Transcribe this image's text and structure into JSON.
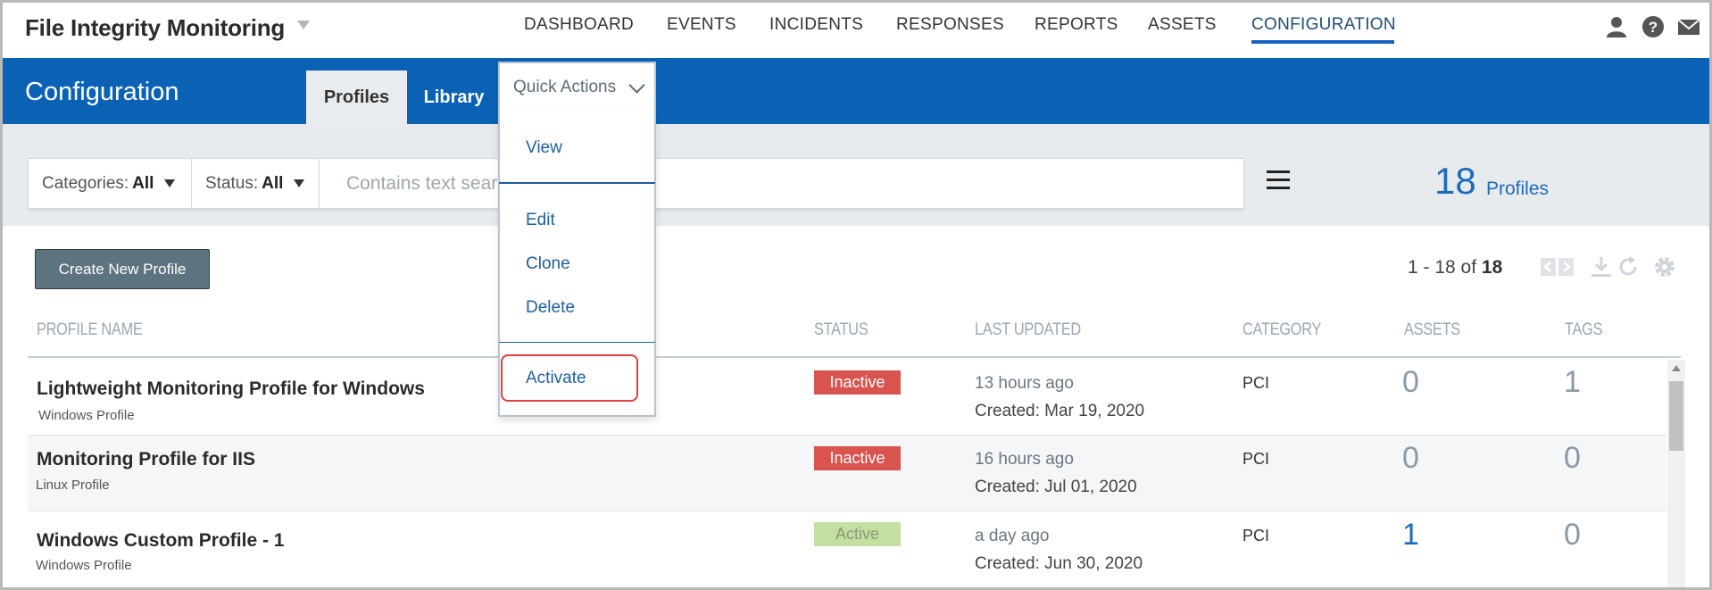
{
  "header": {
    "app_title": "File Integrity Monitoring",
    "nav": [
      "DASHBOARD",
      "EVENTS",
      "INCIDENTS",
      "RESPONSES",
      "REPORTS",
      "ASSETS",
      "CONFIGURATION"
    ],
    "active_nav": "CONFIGURATION",
    "icons": [
      "user-icon",
      "help-icon",
      "mail-icon"
    ]
  },
  "page": {
    "title": "Configuration",
    "tabs": [
      "Profiles",
      "Library"
    ],
    "active_tab": "Profiles"
  },
  "quick_actions": {
    "label": "Quick Actions",
    "items": [
      "View",
      "Edit",
      "Clone",
      "Delete",
      "Activate"
    ],
    "highlighted_item": "Activate"
  },
  "filters": {
    "categories_label": "Categories:",
    "categories_value": "All",
    "status_label": "Status:",
    "status_value": "All",
    "search_placeholder": "Contains text search"
  },
  "summary": {
    "count": "18",
    "count_label": "Profiles"
  },
  "toolbar": {
    "create_button": "Create New Profile",
    "pager_range": "1 - 18 of",
    "pager_total": "18"
  },
  "table": {
    "columns": [
      "PROFILE NAME",
      "STATUS",
      "LAST UPDATED",
      "CATEGORY",
      "ASSETS",
      "TAGS"
    ],
    "rows": [
      {
        "name": "Lightweight Monitoring Profile for Windows",
        "type": "Windows Profile",
        "status": "Inactive",
        "updated": "13 hours ago",
        "created": "Created: Mar 19, 2020",
        "category": "PCI",
        "assets": "0",
        "tags": "1"
      },
      {
        "name": "Monitoring Profile for IIS",
        "type": "Linux Profile",
        "status": "Inactive",
        "updated": "16 hours ago",
        "created": "Created: Jul 01, 2020",
        "category": "PCI",
        "assets": "0",
        "tags": "0"
      },
      {
        "name": "Windows Custom Profile - 1",
        "type": "Windows Profile",
        "status": "Active",
        "updated": "a day ago",
        "created": "Created: Jun 30, 2020",
        "category": "PCI",
        "assets": "1",
        "tags": "0"
      }
    ]
  },
  "colors": {
    "brand_blue": "#0b62b5",
    "inactive_badge": "#d9534f",
    "active_badge": "#c3e0a0",
    "link_blue": "#1e6bb8"
  }
}
